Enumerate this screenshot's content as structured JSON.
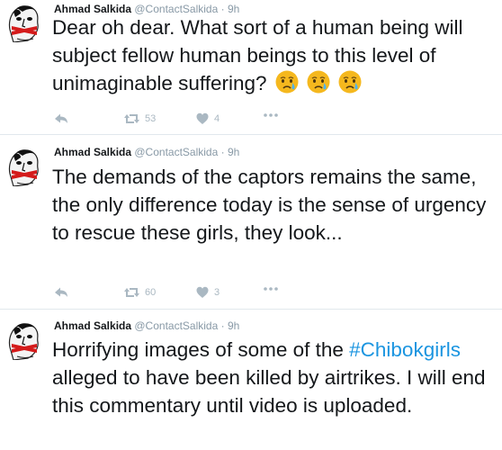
{
  "tweets": [
    {
      "author": "Ahmad Salkida",
      "handle": "@ContactSalkida",
      "separator": "·",
      "time": "9h",
      "text": "Dear oh dear. What sort of a human being will subject fellow human beings to this level of unimaginable suffering?",
      "emoji": [
        "crying-face",
        "crying-face",
        "crying-face"
      ],
      "retweets": "53",
      "likes": "4"
    },
    {
      "author": "Ahmad Salkida",
      "handle": "@ContactSalkida",
      "separator": "·",
      "time": "9h",
      "text": "The demands of the captors remains the same, the only difference today is the sense of urgency to rescue these girls, they look...",
      "retweets": "60",
      "likes": "3"
    },
    {
      "author": "Ahmad Salkida",
      "handle": "@ContactSalkida",
      "separator": "·",
      "time": "9h",
      "text_before": "Horrifying images of some of the ",
      "hashtag": "#Chibokgirls",
      "text_after": " alleged to have been killed by airtrikes. I will end this commentary until video is uploaded."
    }
  ],
  "colors": {
    "link": "#1b95e0",
    "muted": "#8899a6",
    "icon": "#aab8c2",
    "divider": "#e1e8ed"
  }
}
